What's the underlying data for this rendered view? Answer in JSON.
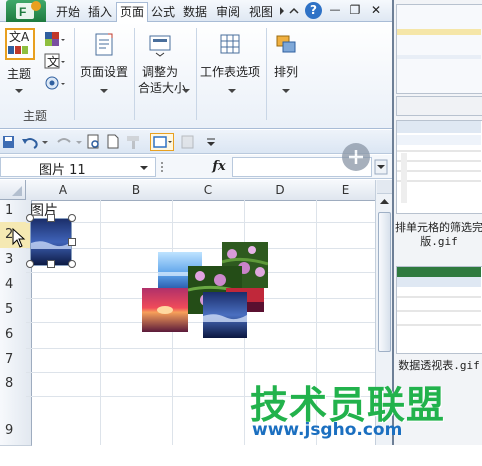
{
  "ribbon_tabs": [
    "开始",
    "插入",
    "页面",
    "公式",
    "数据",
    "审阅",
    "视图"
  ],
  "window_controls": {
    "help": "?",
    "minimize": "—",
    "restore": "❐",
    "close": "✕"
  },
  "ribbon": {
    "theme_label": "主题",
    "theme_group_label": "主题",
    "page_setup": "页面设置",
    "fit_label_line1": "调整为",
    "fit_label_line2": "合适大小",
    "sheet_options": "工作表选项",
    "arrange": "排列",
    "theme_button_text": "文A"
  },
  "formula_bar": {
    "name_box": "图片 11",
    "fx": "fx"
  },
  "columns": [
    "A",
    "B",
    "C",
    "D",
    "E"
  ],
  "rows": [
    "1",
    "2",
    "3",
    "4",
    "5",
    "6",
    "7",
    "8",
    "9"
  ],
  "cells": {
    "A1": "图片"
  },
  "right_panel": {
    "caption1_line1": "排单元格的筛选完",
    "caption1_line2": "版.gif",
    "caption2": "数据透视表.gif"
  },
  "watermark": {
    "title": "技术员联盟",
    "url": "www.jsgho.com"
  },
  "colors": {
    "ribbon_border": "#a9bcd6",
    "header_bg": "#dfe6ef",
    "watermark_green": "#22b24c",
    "watermark_blue": "#1b6fc0"
  }
}
